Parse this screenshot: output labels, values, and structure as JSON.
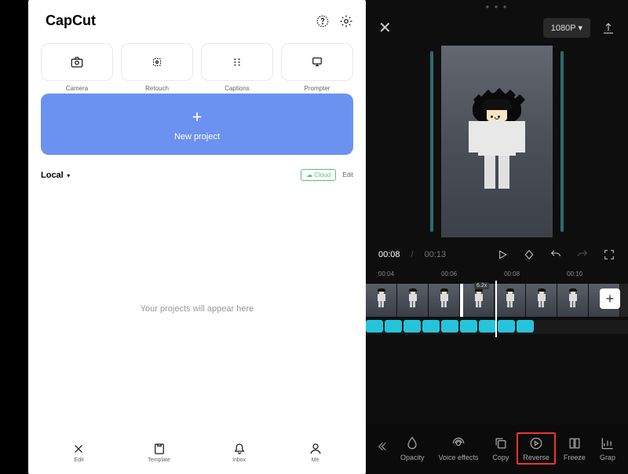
{
  "left": {
    "logo_text": "CapCut",
    "actions": [
      {
        "icon": "camera-icon",
        "label": "Camera"
      },
      {
        "icon": "retouch-icon",
        "label": "Retouch"
      },
      {
        "icon": "captions-icon",
        "label": "Captions"
      },
      {
        "icon": "prompter-icon",
        "label": "Prompter"
      }
    ],
    "new_project_label": "New project",
    "local_label": "Local",
    "cloud_label": "Cloud",
    "edit_label": "Edit",
    "empty_text": "Your projects will appear here",
    "nav": [
      {
        "icon": "edit-nav-icon",
        "label": "Edit"
      },
      {
        "icon": "template-nav-icon",
        "label": "Template"
      },
      {
        "icon": "inbox-nav-icon",
        "label": "Inbox"
      },
      {
        "icon": "me-nav-icon",
        "label": "Me"
      }
    ]
  },
  "right": {
    "resolution": "1080P",
    "time_current": "00:08",
    "time_total": "00:13",
    "ruler": [
      "00:04",
      "00:06",
      "00:08",
      "00:10"
    ],
    "speed_badge": "6.2x",
    "tools": [
      {
        "icon": "opacity-icon",
        "label": "Opacity"
      },
      {
        "icon": "voice-effects-icon",
        "label": "Voice effects"
      },
      {
        "icon": "copy-icon",
        "label": "Copy"
      },
      {
        "icon": "reverse-icon",
        "label": "Reverse",
        "highlight": true
      },
      {
        "icon": "freeze-icon",
        "label": "Freeze"
      },
      {
        "icon": "graph-icon",
        "label": "Grap"
      }
    ]
  }
}
